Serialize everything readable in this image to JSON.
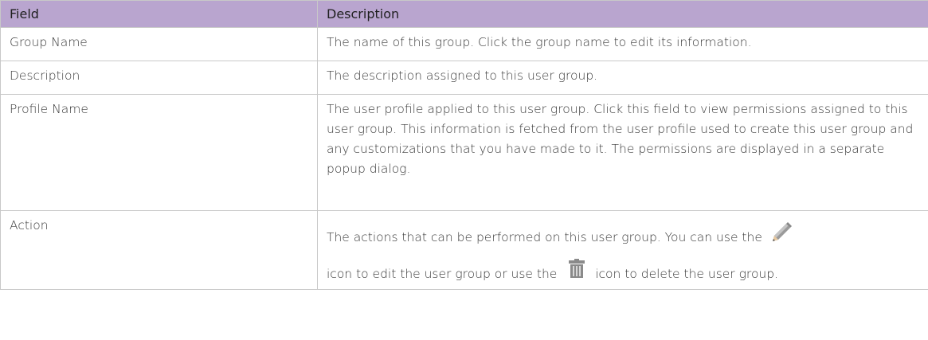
{
  "table": {
    "headers": [
      "Field",
      "Description"
    ],
    "rows": [
      {
        "field": "Group Name",
        "description": "The name of this group. Click the group name to edit its information."
      },
      {
        "field": "Description",
        "description": "The description assigned to this user group."
      },
      {
        "field": "Profile Name",
        "description": "The user profile applied to this user group. Click this field to view permissions assigned to this user group. This information is fetched from the user profile used to create this user group and any customizations that you have made to it. The permissions are displayed in a separate popup dialog."
      },
      {
        "field": "Action",
        "description_part1": "The actions that can be performed on this user group. You can use the",
        "description_part2": "icon to edit the user group or use the",
        "description_part3": "icon to delete the user group."
      }
    ]
  },
  "icons": {
    "edit": "pencil-icon",
    "delete": "trash-icon"
  },
  "colors": {
    "header_bg": "#b9a5cf",
    "border": "#c8c8c8"
  }
}
